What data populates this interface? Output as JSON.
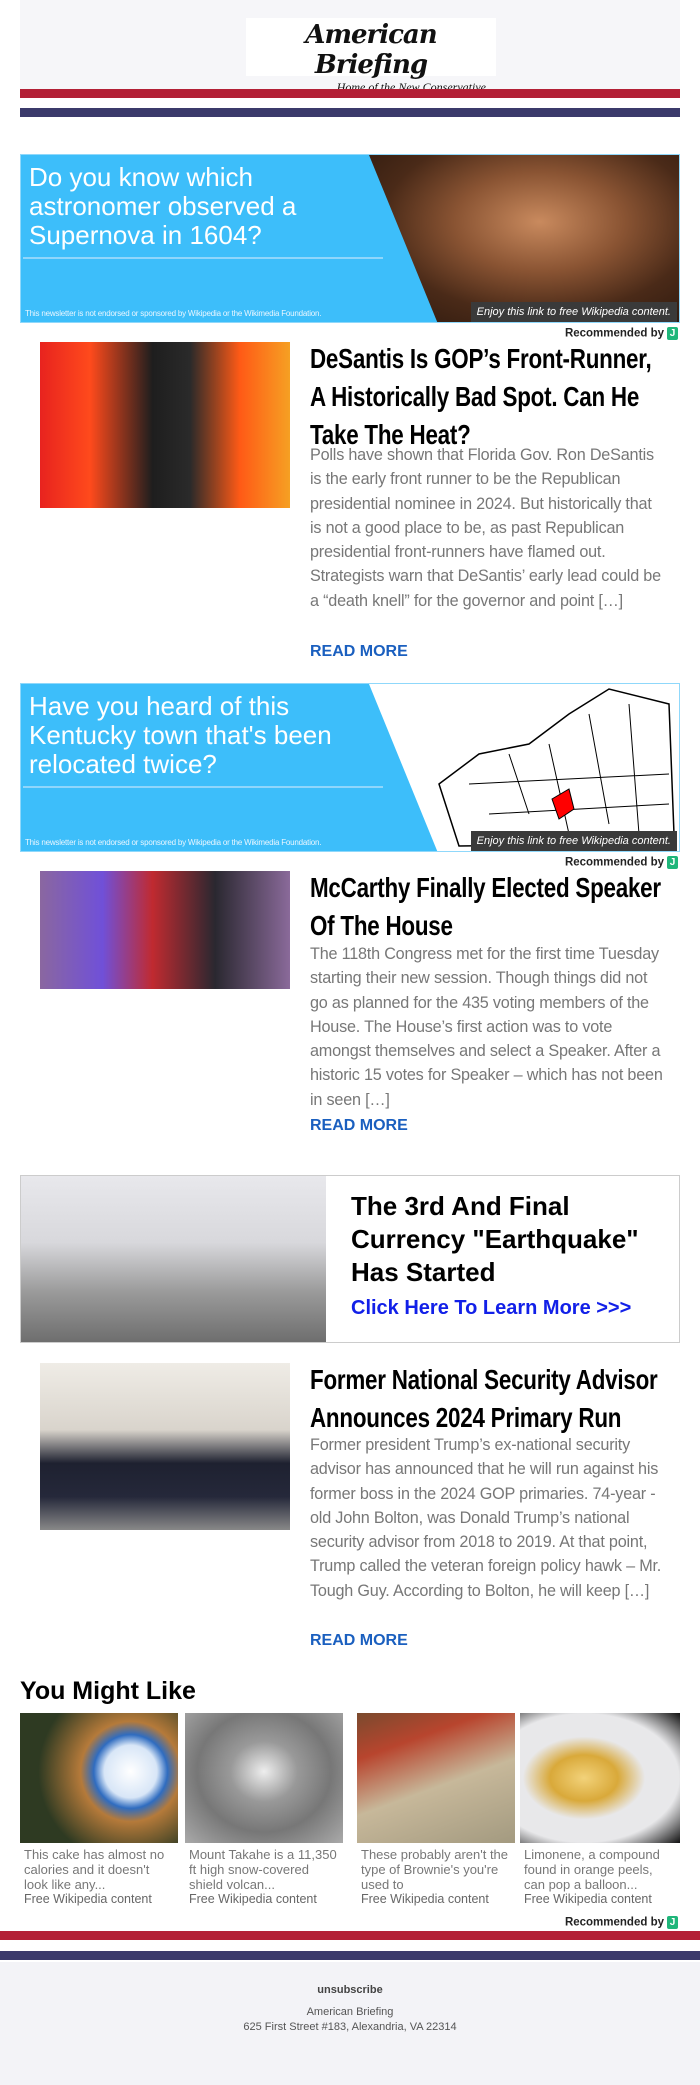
{
  "header": {
    "logo_title": "American Briefing",
    "logo_tagline": "Home of the New Conservative"
  },
  "colors": {
    "red": "#b32036",
    "navy": "#3b3a6b",
    "wiki_blue": "#3dbefa",
    "link": "#1a5fbf"
  },
  "recommended_label": "Recommended by",
  "recommended_logo": "J",
  "wiki_banners": [
    {
      "question": "Do you know which astronomer observed a Supernova in 1604?",
      "disclaimer": "This newsletter is not endorsed or sponsored by Wikipedia or the Wikimedia Foundation.",
      "caption": "Enjoy this link to free Wikipedia content."
    },
    {
      "question": "Have you heard of this Kentucky town that's been relocated twice?",
      "disclaimer": "This newsletter is not endorsed or sponsored by Wikipedia or the Wikimedia Foundation.",
      "caption": "Enjoy this link to free Wikipedia content."
    }
  ],
  "articles": [
    {
      "title": "DeSantis Is GOP’s Front-Runner, A Historically Bad Spot. Can He Take The Heat?",
      "body": "Polls have shown that Florida Gov. Ron DeSantis is the early front runner to be the Republican presidential nominee in 2024. But historically that is not a good place to be, as past Republican presidential front-runners have flamed out. Strategists warn that DeSantis’ early lead could be a “death knell” for the governor and point […]",
      "read_more": "READ MORE"
    },
    {
      "title": "McCarthy Finally Elected Speaker Of The House",
      "body": "The 118th Congress met for the first time Tuesday starting their new session. Though things did not go as planned for the 435 voting members of the House. The House’s first action was to vote amongst themselves and select a Speaker. After a historic 15 votes for Speaker – which has not been in seen […]",
      "read_more": "READ MORE"
    },
    {
      "title": "Former National Security Advisor Announces 2024 Primary Run",
      "body": "Former president Trump’s ex-national security advisor has announced that he will run against his former boss in the 2024 GOP primaries. 74-year -old John Bolton, was Donald Trump’s national security advisor from 2018 to 2019. At that point, Trump called the veteran foreign policy hawk – Mr. Tough Guy. According to Bolton, he will keep […]",
      "read_more": "READ MORE"
    }
  ],
  "ad": {
    "headline": "The 3rd And Final Currency \"Earthquake\" Has Started",
    "cta": "Click Here To Learn More >>>"
  },
  "you_might_like": {
    "heading": "You Might Like",
    "items": [
      {
        "text": "This cake has almost no calories and it doesn't look like any...",
        "source": "Free Wikipedia content"
      },
      {
        "text": "Mount Takahe is a 11,350 ft high snow-covered shield volcan...",
        "source": "Free Wikipedia content"
      },
      {
        "text": "These probably aren't the type of Brownie's you're used to",
        "source": "Free Wikipedia content"
      },
      {
        "text": "Limonene, a compound found in orange peels, can pop a balloon...",
        "source": "Free Wikipedia content"
      }
    ]
  },
  "footer": {
    "unsubscribe": "unsubscribe",
    "company": "American Briefing",
    "address": "625 First Street #183, Alexandria, VA 22314"
  }
}
